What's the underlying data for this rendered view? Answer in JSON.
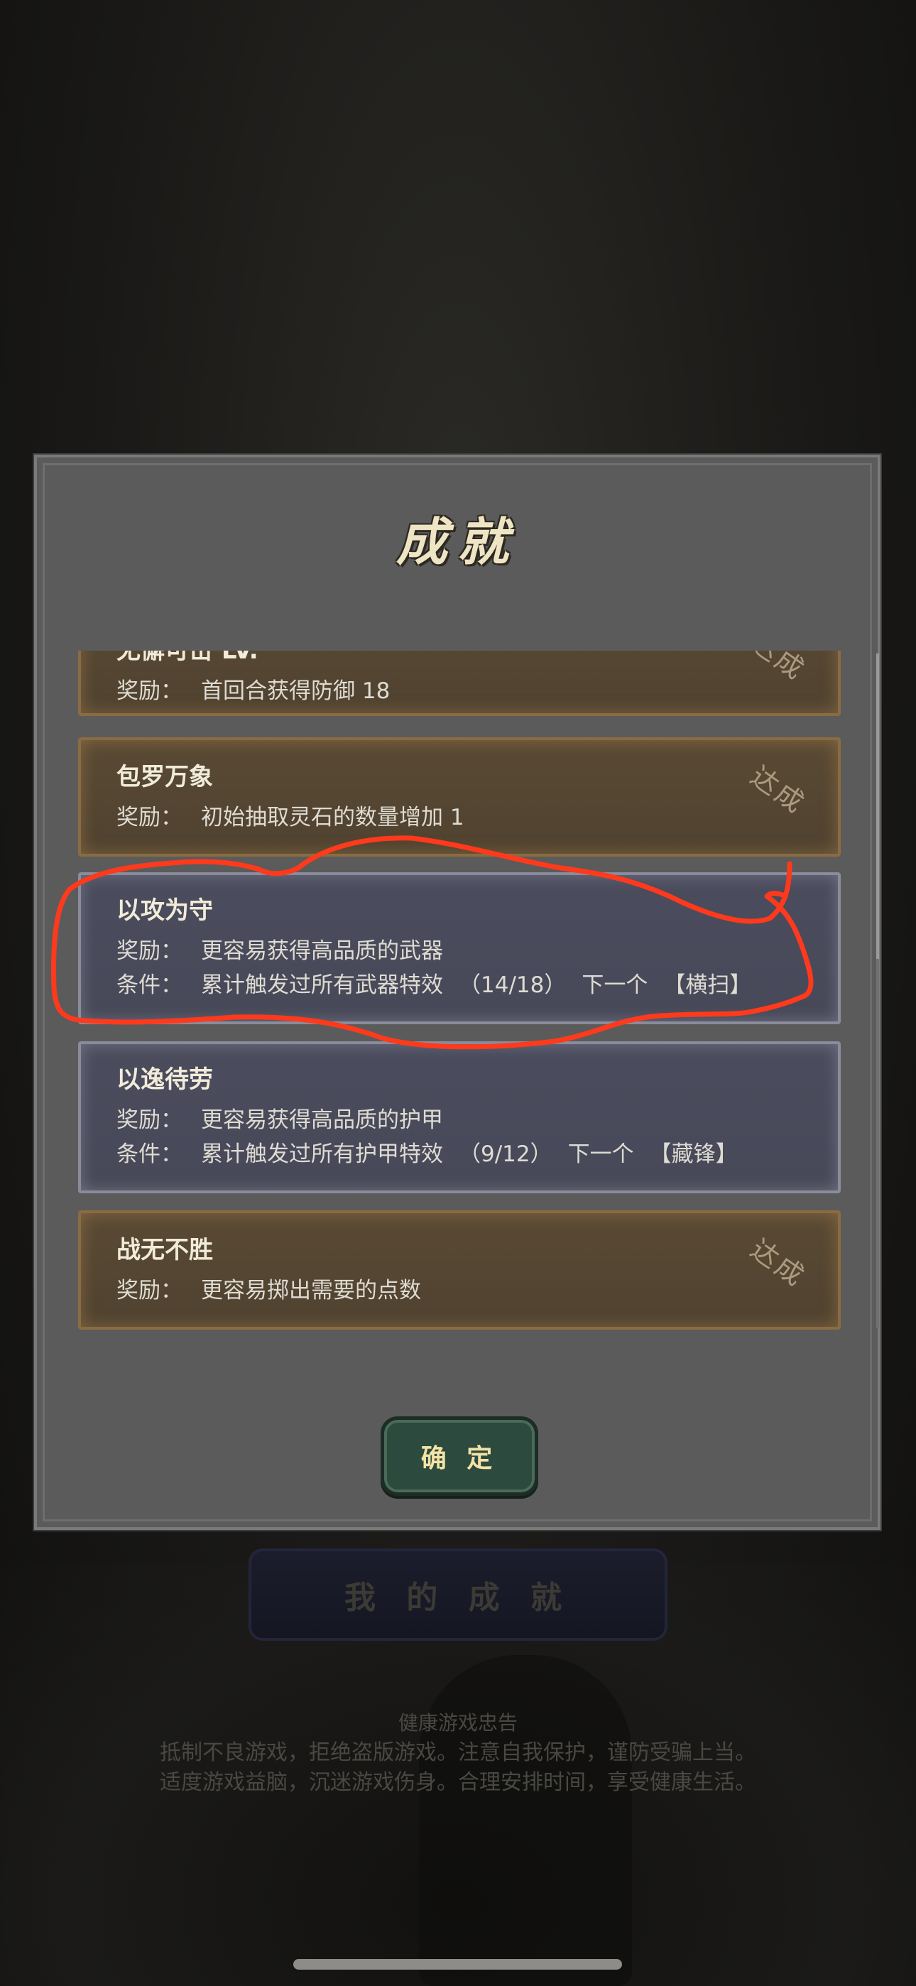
{
  "background": {
    "my_achievements_button": "我 的 成 就",
    "health_notice": {
      "title": "健康游戏忠告",
      "line1": "抵制不良游戏，拒绝盗版游戏。注意自我保护，谨防受骗上当。",
      "line2": "适度游戏益脑，沉迷游戏伤身。合理安排时间，享受健康生活。"
    }
  },
  "modal": {
    "title": "成就",
    "confirm_label": "确 定",
    "achievements": [
      {
        "name": "无懈可击 LV.",
        "reward_label": "奖励：",
        "reward": "首回合获得防御 18",
        "status": "达成",
        "completed": true
      },
      {
        "name": "包罗万象",
        "reward_label": "奖励：",
        "reward": "初始抽取灵石的数量增加 1",
        "status": "达成",
        "completed": true
      },
      {
        "name": "以攻为守",
        "reward_label": "奖励：",
        "reward": "更容易获得高品质的武器",
        "condition_label": "条件：",
        "condition": "累计触发过所有武器特效",
        "progress": "（14/18）",
        "next": "下一个",
        "next_item": "【横扫】",
        "completed": false
      },
      {
        "name": "以逸待劳",
        "reward_label": "奖励：",
        "reward": "更容易获得高品质的护甲",
        "condition_label": "条件：",
        "condition": "累计触发过所有护甲特效",
        "progress": "（9/12）",
        "next": "下一个",
        "next_item": "【藏锋】",
        "completed": false
      },
      {
        "name": "战无不胜",
        "reward_label": "奖励：",
        "reward": "更容易掷出需要的点数",
        "status": "达成",
        "completed": true
      }
    ]
  },
  "colors": {
    "completed_card": "#5a4a34",
    "progress_card": "#4b4c5d",
    "annotation_stroke": "#ff3a1c",
    "confirm_button": "#2d4a3e"
  },
  "annotation": {
    "shape": "hand-drawn-loop",
    "target": "以攻为守"
  }
}
